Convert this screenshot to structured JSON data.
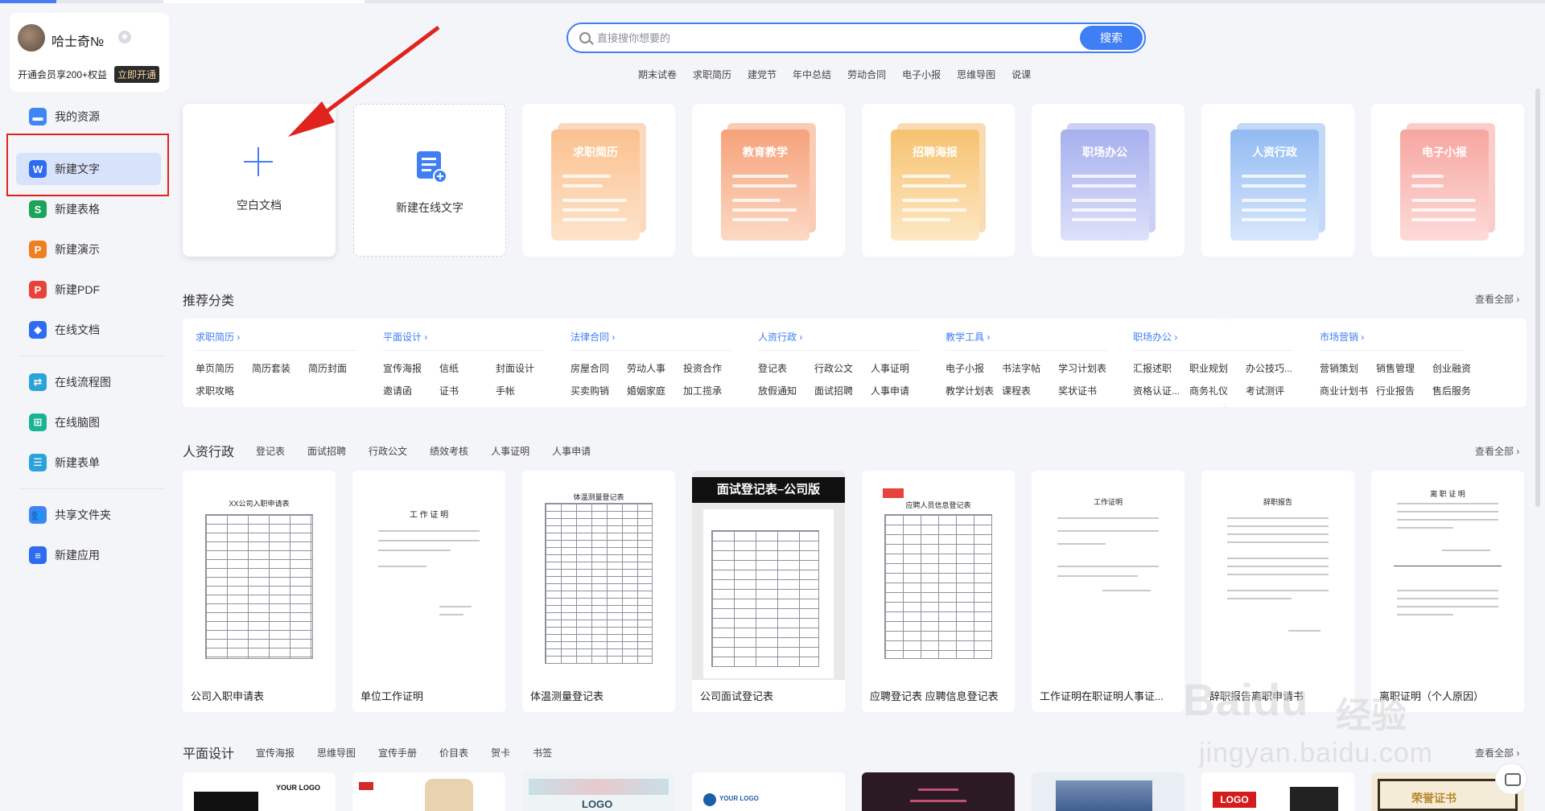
{
  "user": {
    "name": "哈士奇№",
    "vip_text": "开通会员享200+权益",
    "vip_button": "立即开通"
  },
  "sidebar": {
    "items": [
      {
        "label": "我的资源",
        "icon": "folder-icon",
        "color": "#3f86f5"
      },
      {
        "label": "新建文字",
        "icon": "word-icon",
        "color": "#2d6cf0"
      },
      {
        "label": "新建表格",
        "icon": "sheet-icon",
        "color": "#1ca35c"
      },
      {
        "label": "新建演示",
        "icon": "slides-icon",
        "color": "#f0801f"
      },
      {
        "label": "新建PDF",
        "icon": "pdf-icon",
        "color": "#e8433a"
      },
      {
        "label": "在线文档",
        "icon": "cloud-doc-icon",
        "color": "#2d6cf0"
      },
      {
        "label": "在线流程图",
        "icon": "flowchart-icon",
        "color": "#2aa3d8"
      },
      {
        "label": "在线脑图",
        "icon": "mindmap-icon",
        "color": "#1ab394"
      },
      {
        "label": "新建表单",
        "icon": "form-icon",
        "color": "#2aa3d8"
      },
      {
        "label": "共享文件夹",
        "icon": "shared-folder-icon",
        "color": "#3f86f5"
      },
      {
        "label": "新建应用",
        "icon": "app-icon",
        "color": "#2d6cf0"
      }
    ]
  },
  "search": {
    "placeholder": "直接搜你想要的",
    "button": "搜索",
    "hot_tags": [
      "期末试卷",
      "求职简历",
      "建党节",
      "年中总结",
      "劳动合同",
      "电子小报",
      "思维导图",
      "说课"
    ]
  },
  "create_cards": {
    "blank": "空白文档",
    "online": "新建在线文字",
    "templates": [
      {
        "title": "求职简历",
        "color": "#f9a86d"
      },
      {
        "title": "教育教学",
        "color": "#f38c5a"
      },
      {
        "title": "招聘海报",
        "color": "#f5b158"
      },
      {
        "title": "职场办公",
        "color": "#8d97e6"
      },
      {
        "title": "人资行政",
        "color": "#7aaaf0"
      },
      {
        "title": "电子小报",
        "color": "#f5908b"
      }
    ]
  },
  "recommend": {
    "title": "推荐分类",
    "view_all": "查看全部",
    "columns": [
      {
        "head": "求职简历",
        "items": [
          "单页简历",
          "简历套装",
          "简历封面",
          "求职攻略"
        ]
      },
      {
        "head": "平面设计",
        "items": [
          "宣传海报",
          "信纸",
          "封面设计",
          "邀请函",
          "证书",
          "手帐"
        ]
      },
      {
        "head": "法律合同",
        "items": [
          "房屋合同",
          "劳动人事",
          "投资合作",
          "买卖购销",
          "婚姻家庭",
          "加工揽承"
        ]
      },
      {
        "head": "人资行政",
        "items": [
          "登记表",
          "行政公文",
          "人事证明",
          "放假通知",
          "面试招聘",
          "人事申请"
        ]
      },
      {
        "head": "教学工具",
        "items": [
          "电子小报",
          "书法字帖",
          "学习计划表",
          "教学计划表",
          "课程表",
          "奖状证书"
        ]
      },
      {
        "head": "职场办公",
        "items": [
          "汇报述职",
          "职业规划",
          "办公技巧...",
          "资格认证...",
          "商务礼仪",
          "考试测评"
        ]
      },
      {
        "head": "市场营销",
        "items": [
          "营销策划",
          "销售管理",
          "创业融资",
          "商业计划书",
          "行业报告",
          "售后服务"
        ]
      }
    ]
  },
  "hr_section": {
    "title": "人资行政",
    "tabs": [
      "登记表",
      "面试招聘",
      "行政公文",
      "绩效考核",
      "人事证明",
      "人事申请"
    ],
    "view_all": "查看全部",
    "docs": [
      {
        "name": "公司入职申请表",
        "thumb_title": "XX公司入职申请表"
      },
      {
        "name": "单位工作证明",
        "thumb_title": "工 作 证 明"
      },
      {
        "name": "体温测量登记表",
        "thumb_title": "体温测量登记表"
      },
      {
        "name": "公司面试登记表",
        "thumb_title": "面试登记表–公司版"
      },
      {
        "name": "应聘登记表 应聘信息登记表",
        "thumb_title": "应聘人员信息登记表"
      },
      {
        "name": "工作证明在职证明人事证...",
        "thumb_title": "工作证明"
      },
      {
        "name": "辞职报告离职申请书",
        "thumb_title": "辞职报告"
      },
      {
        "name": "离职证明（个人原因）",
        "thumb_title": "离 职 证 明"
      }
    ]
  },
  "design_section": {
    "title": "平面设计",
    "tabs": [
      "宣传海报",
      "思维导图",
      "宣传手册",
      "价目表",
      "贺卡",
      "书签"
    ],
    "view_all": "查看全部",
    "previews": [
      {
        "text": "YOUR LOGO",
        "color": "#111111"
      },
      {
        "text": "",
        "color": "#e8d2b0"
      },
      {
        "text": "LOGO",
        "color": "#c9dfe8"
      },
      {
        "text": "YOUR LOGO",
        "color": "#1d5ea8"
      },
      {
        "text": "",
        "color": "#2b1a24"
      },
      {
        "text": "",
        "color": "#7a93b8"
      },
      {
        "text": "LOGO",
        "color": "#d41c1c"
      },
      {
        "text": "荣誉证书",
        "color": "#c79a4a"
      }
    ]
  },
  "watermark": {
    "text1": "Baidu",
    "text2": "jingyan.baidu.com",
    "text3": "经验"
  }
}
